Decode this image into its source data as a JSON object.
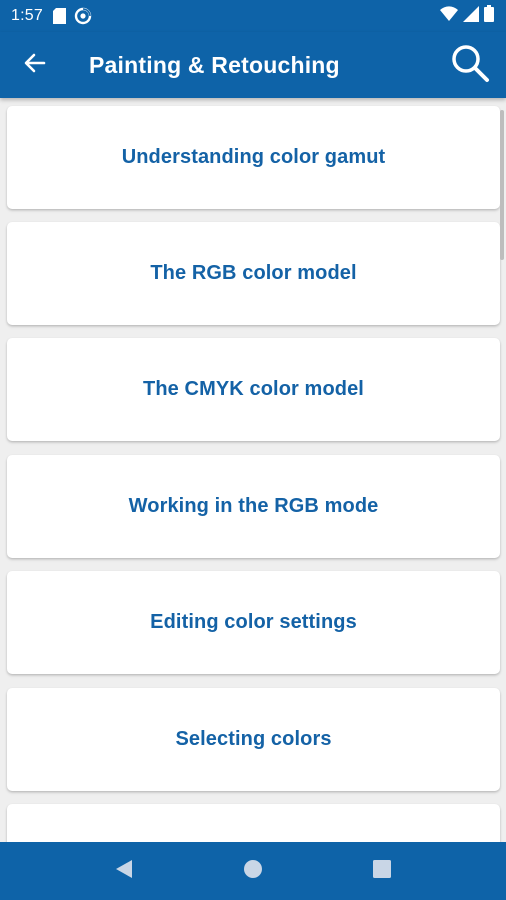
{
  "status_bar": {
    "time": "1:57",
    "icons": [
      "sd-card-icon",
      "data-saver-icon",
      "wifi-icon",
      "signal-icon",
      "battery-icon"
    ]
  },
  "app_bar": {
    "back_icon": "arrow-left-icon",
    "title": "Painting & Retouching",
    "search_icon": "search-icon"
  },
  "topics": [
    {
      "label": "Understanding color gamut"
    },
    {
      "label": "The RGB color model"
    },
    {
      "label": "The CMYK color model"
    },
    {
      "label": "Working in the RGB mode"
    },
    {
      "label": "Editing color settings"
    },
    {
      "label": "Selecting colors"
    },
    {
      "label": ""
    }
  ],
  "nav_bar": {
    "icons": [
      "back-triangle-icon",
      "home-circle-icon",
      "recents-square-icon"
    ]
  },
  "colors": {
    "primary": "#0e63a8",
    "card_text": "#1462a6",
    "background": "#efefef",
    "card": "#ffffff"
  }
}
